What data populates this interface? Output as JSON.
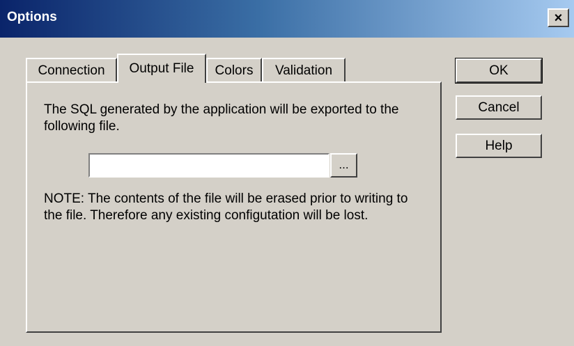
{
  "window": {
    "title": "Options",
    "close_symbol": "×"
  },
  "tabs": [
    {
      "label": "Connection",
      "active": false
    },
    {
      "label": "Output File",
      "active": true
    },
    {
      "label": "Colors",
      "active": false
    },
    {
      "label": "Validation",
      "active": false
    }
  ],
  "panel": {
    "description": "The SQL generated by the application will be exported to the following file.",
    "file_path_value": "",
    "browse_label": "...",
    "note": "NOTE: The contents of the file will be erased prior to writing to the file. Therefore any existing configutation will be lost."
  },
  "buttons": {
    "ok": "OK",
    "cancel": "Cancel",
    "help": "Help"
  },
  "colors": {
    "title_bar_start": "#0a246a",
    "title_bar_end": "#a6caf0",
    "face": "#d4d0c8"
  }
}
